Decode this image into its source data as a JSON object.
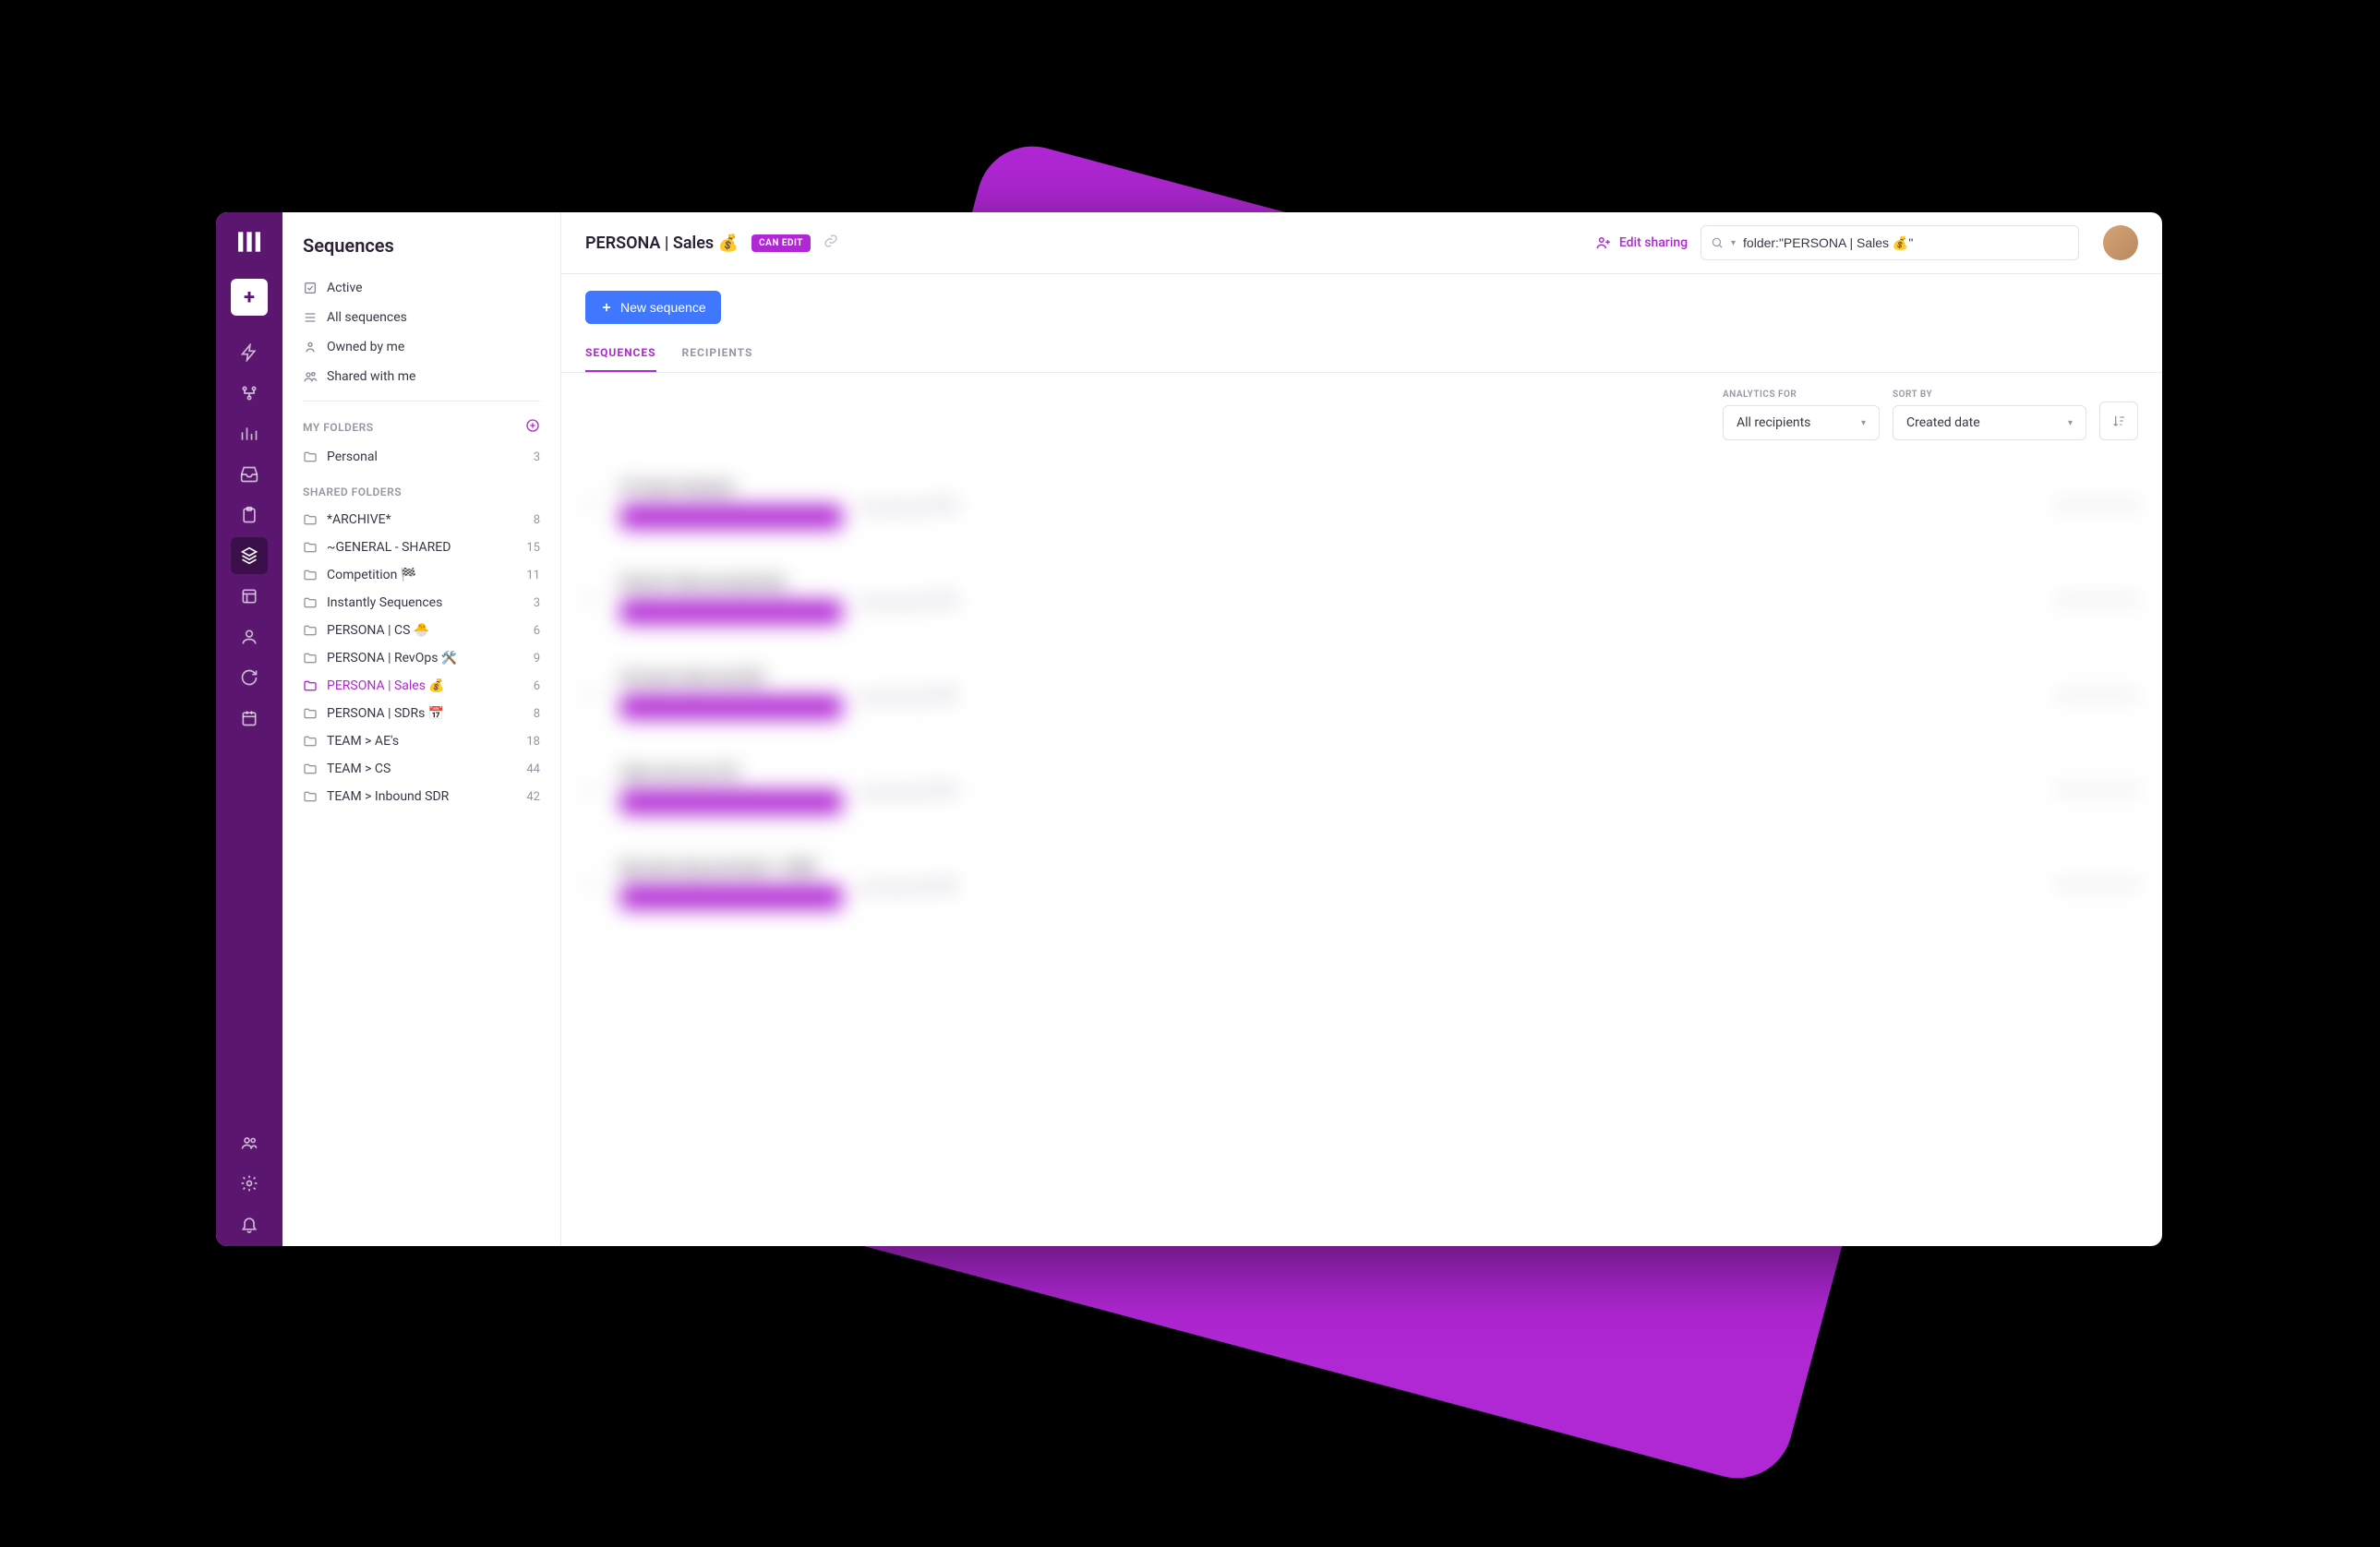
{
  "sidebar": {
    "title": "Sequences",
    "filters": [
      {
        "label": "Active",
        "icon": "check-square"
      },
      {
        "label": "All sequences",
        "icon": "list"
      },
      {
        "label": "Owned by me",
        "icon": "user"
      },
      {
        "label": "Shared with me",
        "icon": "users"
      }
    ],
    "sections": {
      "my_folders_label": "MY FOLDERS",
      "shared_folders_label": "SHARED FOLDERS"
    },
    "my_folders": [
      {
        "name": "Personal",
        "count": "3"
      }
    ],
    "shared_folders": [
      {
        "name": "*ARCHIVE*",
        "count": "8"
      },
      {
        "name": "~GENERAL - SHARED",
        "count": "15"
      },
      {
        "name": "Competition 🏁",
        "count": "11"
      },
      {
        "name": "Instantly Sequences",
        "count": "3"
      },
      {
        "name": "PERSONA | CS 🐣",
        "count": "6"
      },
      {
        "name": "PERSONA | RevOps 🛠️",
        "count": "9"
      },
      {
        "name": "PERSONA | Sales 💰",
        "count": "6",
        "selected": true
      },
      {
        "name": "PERSONA | SDRs 📅",
        "count": "8"
      },
      {
        "name": "TEAM > AE's",
        "count": "18"
      },
      {
        "name": "TEAM > CS",
        "count": "44"
      },
      {
        "name": "TEAM > Inbound SDR",
        "count": "42"
      }
    ]
  },
  "header": {
    "title": "PERSONA | Sales 💰",
    "badge": "CAN EDIT",
    "edit_sharing": "Edit sharing",
    "search_value": "folder:\"PERSONA | Sales 💰\""
  },
  "toolbar": {
    "new_sequence": "New sequence"
  },
  "tabs": {
    "sequences": "SEQUENCES",
    "recipients": "RECIPIENTS"
  },
  "controls": {
    "analytics_label": "ANALYTICS FOR",
    "analytics_value": "All recipients",
    "sort_label": "SORT BY",
    "sort_value": "Created date"
  },
  "rows": [
    {
      "title": "VP sales Outreach"
    },
    {
      "title": "Director Sales prospecting"
    },
    {
      "title": "AE reach wide nets BIG"
    },
    {
      "title": "Sales exec top 100"
    },
    {
      "title": "Big sales play persistent - WIDE"
    }
  ]
}
